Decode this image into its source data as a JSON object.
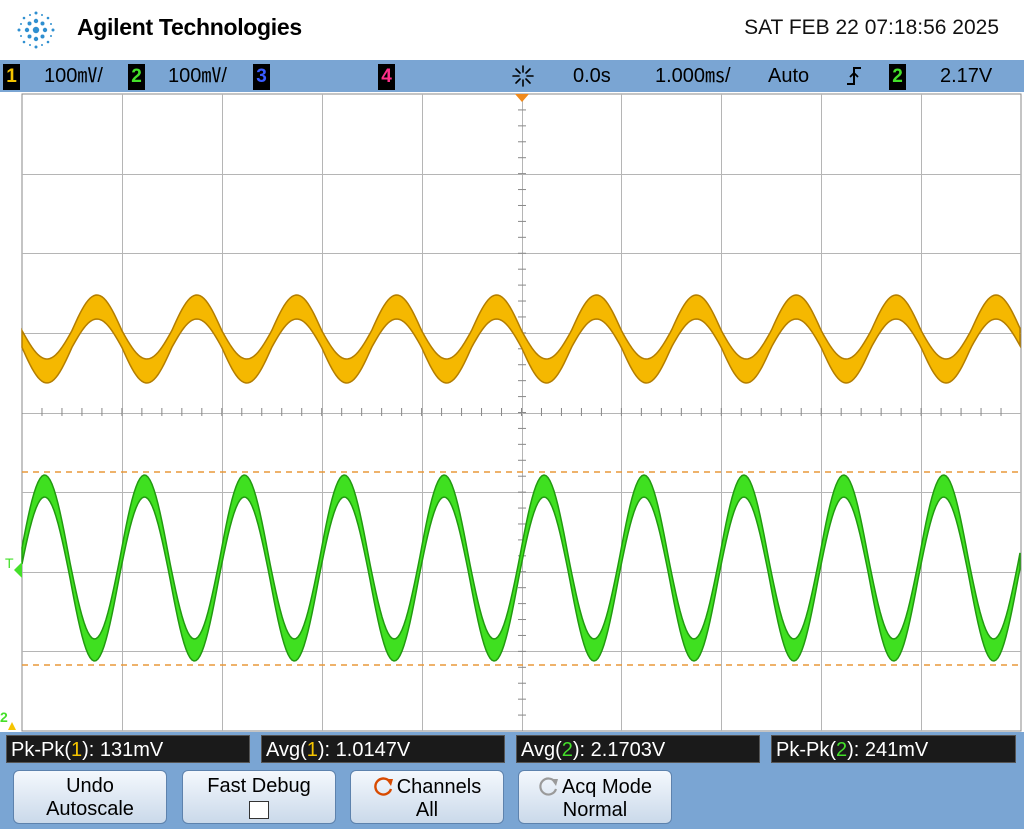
{
  "header": {
    "brand": "Agilent Technologies",
    "datetime": "SAT FEB 22 07:18:56 2025"
  },
  "status": {
    "ch1": {
      "num": "1",
      "scale": "100㎷/",
      "color": "#f5c400"
    },
    "ch2": {
      "num": "2",
      "scale": "100㎷/",
      "color": "#44e02a"
    },
    "ch3": {
      "num": "3",
      "color": "#3a5cff"
    },
    "ch4": {
      "num": "4",
      "color": "#ff2f8a"
    },
    "time_icon": "trigger-position-icon",
    "delay": "0.0s",
    "timebase": "1.000㎳/",
    "trigger_mode": "Auto",
    "trigger_slope_icon": "rising-edge-icon",
    "trigger_source": "2",
    "trigger_level": "2.17V"
  },
  "measurements": [
    {
      "prefix": "Pk-Pk(",
      "ch": "1",
      "suffix": "): 131mV"
    },
    {
      "prefix": "Avg(",
      "ch": "1",
      "suffix": "): 1.0147V"
    },
    {
      "prefix": "Avg(",
      "ch": "2",
      "suffix": "): 2.1703V"
    },
    {
      "prefix": "Pk-Pk(",
      "ch": "2",
      "suffix": "): 241mV"
    }
  ],
  "softkeys": [
    {
      "line1": "Undo",
      "line2": "Autoscale"
    },
    {
      "line1": "Fast Debug",
      "line2": ""
    },
    {
      "line1": "Channels",
      "line2": "All"
    },
    {
      "line1": "Acq Mode",
      "line2": "Normal"
    }
  ],
  "screen_markers": {
    "trigger_label": "T",
    "ground2_label": "2"
  },
  "waveforms": {
    "periods_on_screen": 10,
    "ch1_color": "#f5b800",
    "ch1_edge_color": "#b37d00",
    "ch2_color": "#3fe020",
    "ch2_edge_color": "#229a10",
    "cursor_color": "#e8983a"
  }
}
